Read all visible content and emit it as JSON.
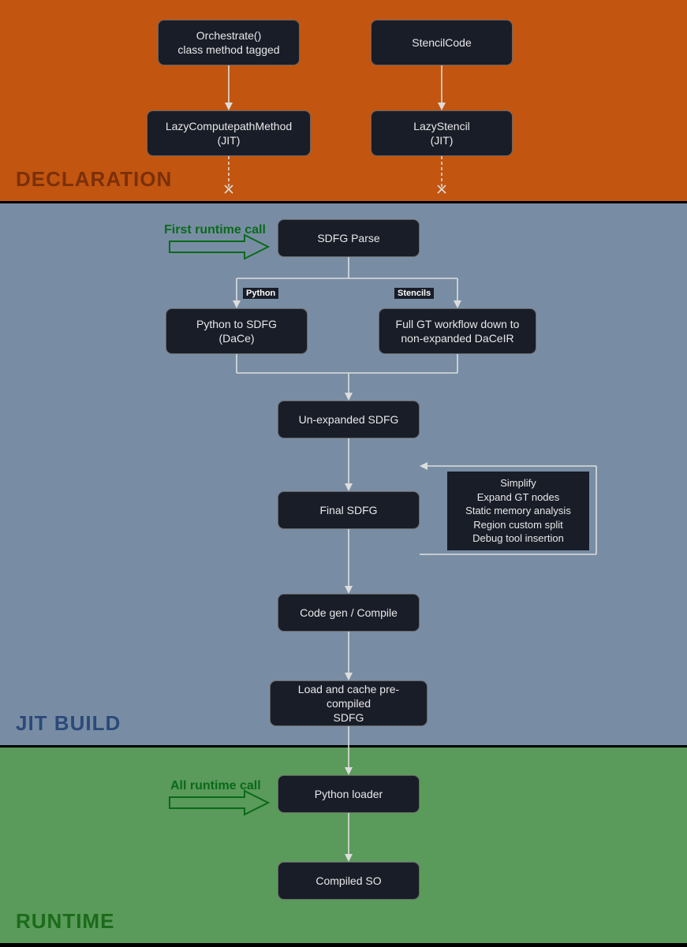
{
  "sections": {
    "declaration": {
      "label": "DECLARATION"
    },
    "jitbuild": {
      "label": "JIT BUILD"
    },
    "runtime": {
      "label": "RUNTIME"
    }
  },
  "nodes": {
    "orchestrate": {
      "line1": "Orchestrate()",
      "line2": "class method tagged"
    },
    "stencilcode": {
      "line1": "StencilCode"
    },
    "lazyMethod": {
      "line1": "LazyComputepathMethod",
      "line2": "(JIT)"
    },
    "lazyStencil": {
      "line1": "LazyStencil",
      "line2": "(JIT)"
    },
    "sdfgParse": {
      "line1": "SDFG Parse"
    },
    "py2sdfg": {
      "line1": "Python to SDFG",
      "line2": "(DaCe)"
    },
    "fullGT": {
      "line1": "Full GT workflow down to",
      "line2": "non-expanded DaCeIR"
    },
    "unexpanded": {
      "line1": "Un-expanded SDFG"
    },
    "finalSDFG": {
      "line1": "Final SDFG"
    },
    "codegen": {
      "line1": "Code gen / Compile"
    },
    "loadcache": {
      "line1": "Load and cache pre-compiled",
      "line2": "SDFG"
    },
    "pyloader": {
      "line1": "Python loader"
    },
    "compiledSO": {
      "line1": "Compiled SO"
    }
  },
  "annotations": {
    "steps": {
      "l1": "Simplify",
      "l2": "Expand GT nodes",
      "l3": "Static memory analysis",
      "l4": "Region custom split",
      "l5": "Debug tool insertion"
    }
  },
  "edgeLabels": {
    "python": "Python",
    "stencils": "Stencils"
  },
  "callouts": {
    "first": "First runtime call",
    "all": "All runtime call"
  }
}
